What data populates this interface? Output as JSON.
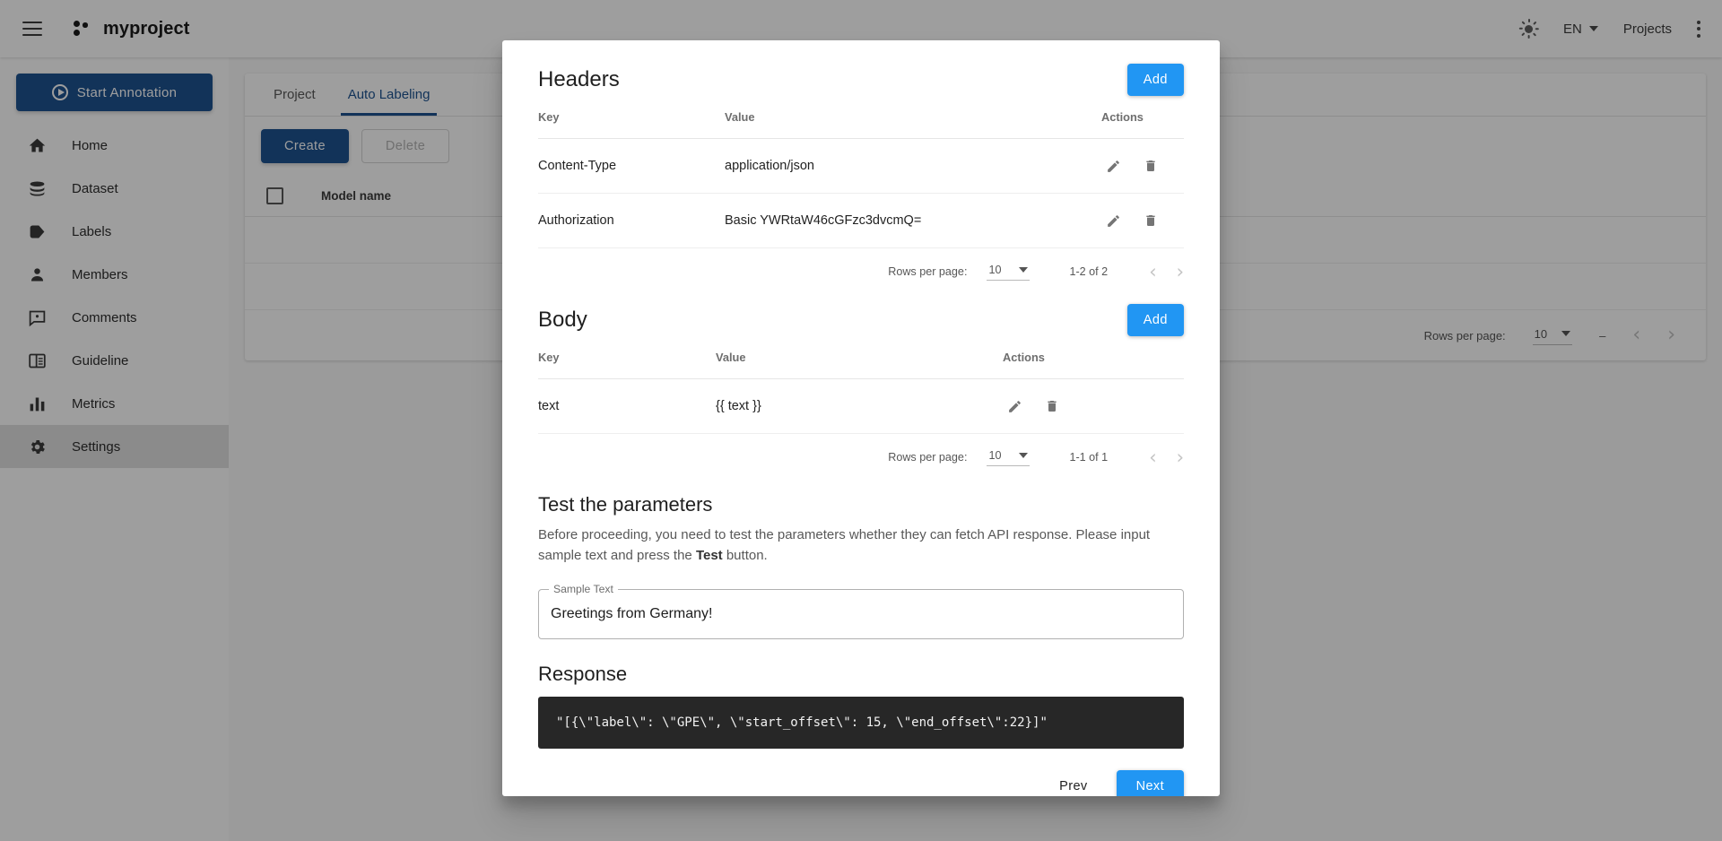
{
  "topbar": {
    "menu_icon": "hamburger-icon",
    "brand": "myproject",
    "theme_icon": "sun-icon",
    "language": "EN",
    "projects_label": "Projects",
    "more_icon": "kebab-menu-icon"
  },
  "sidebar": {
    "start_button": "Start Annotation",
    "items": [
      {
        "label": "Home",
        "icon": "home-icon",
        "active": false
      },
      {
        "label": "Dataset",
        "icon": "database-icon",
        "active": false
      },
      {
        "label": "Labels",
        "icon": "tag-icon",
        "active": false
      },
      {
        "label": "Members",
        "icon": "person-icon",
        "active": false
      },
      {
        "label": "Comments",
        "icon": "comment-icon",
        "active": false
      },
      {
        "label": "Guideline",
        "icon": "book-icon",
        "active": false
      },
      {
        "label": "Metrics",
        "icon": "bar-chart-icon",
        "active": false
      },
      {
        "label": "Settings",
        "icon": "gear-icon",
        "active": true
      }
    ]
  },
  "content": {
    "tabs": [
      {
        "label": "Project",
        "active": false
      },
      {
        "label": "Auto Labeling",
        "active": true
      }
    ],
    "create_label": "Create",
    "delete_label": "Delete",
    "table_header": "Model name",
    "pager": {
      "rows_label": "Rows per page:",
      "rows_value": "10",
      "range": "–",
      "prev_icon": "chevron-left-icon",
      "next_icon": "chevron-right-icon"
    }
  },
  "modal": {
    "headers_section": {
      "title": "Headers",
      "add_label": "Add",
      "columns": [
        "Key",
        "Value",
        "Actions"
      ],
      "rows": [
        {
          "key": "Content-Type",
          "value": "application/json"
        },
        {
          "key": "Authorization",
          "value": "Basic YWRtaW46cGFzc3dvcmQ="
        }
      ],
      "pager": {
        "rows_label": "Rows per page:",
        "rows_value": "10",
        "range": "1-2 of 2",
        "prev_icon": "chevron-left-icon",
        "next_icon": "chevron-right-icon"
      }
    },
    "body_section": {
      "title": "Body",
      "add_label": "Add",
      "columns": [
        "Key",
        "Value",
        "Actions"
      ],
      "rows": [
        {
          "key": "text",
          "value": "{{ text }}"
        }
      ],
      "pager": {
        "rows_label": "Rows per page:",
        "rows_value": "10",
        "range": "1-1 of 1",
        "prev_icon": "chevron-left-icon",
        "next_icon": "chevron-right-icon"
      }
    },
    "test_section": {
      "title": "Test the parameters",
      "description_part1": "Before proceeding, you need to test the parameters whether they can fetch API response. Please input sample text and press the ",
      "description_bold": "Test",
      "description_part2": " button.",
      "field_legend": "Sample Text",
      "field_value": "Greetings from Germany!"
    },
    "response_section": {
      "title": "Response",
      "code": "\"[{\\\"label\\\": \\\"GPE\\\", \\\"start_offset\\\": 15, \\\"end_offset\\\":22}]\""
    },
    "footer": {
      "prev_label": "Prev",
      "next_label": "Next"
    },
    "row_actions": {
      "edit_icon": "pencil-icon",
      "delete_icon": "trash-icon"
    }
  },
  "colors": {
    "primary": "#1e5390",
    "accent": "#2196f3",
    "code_bg": "#272727"
  }
}
